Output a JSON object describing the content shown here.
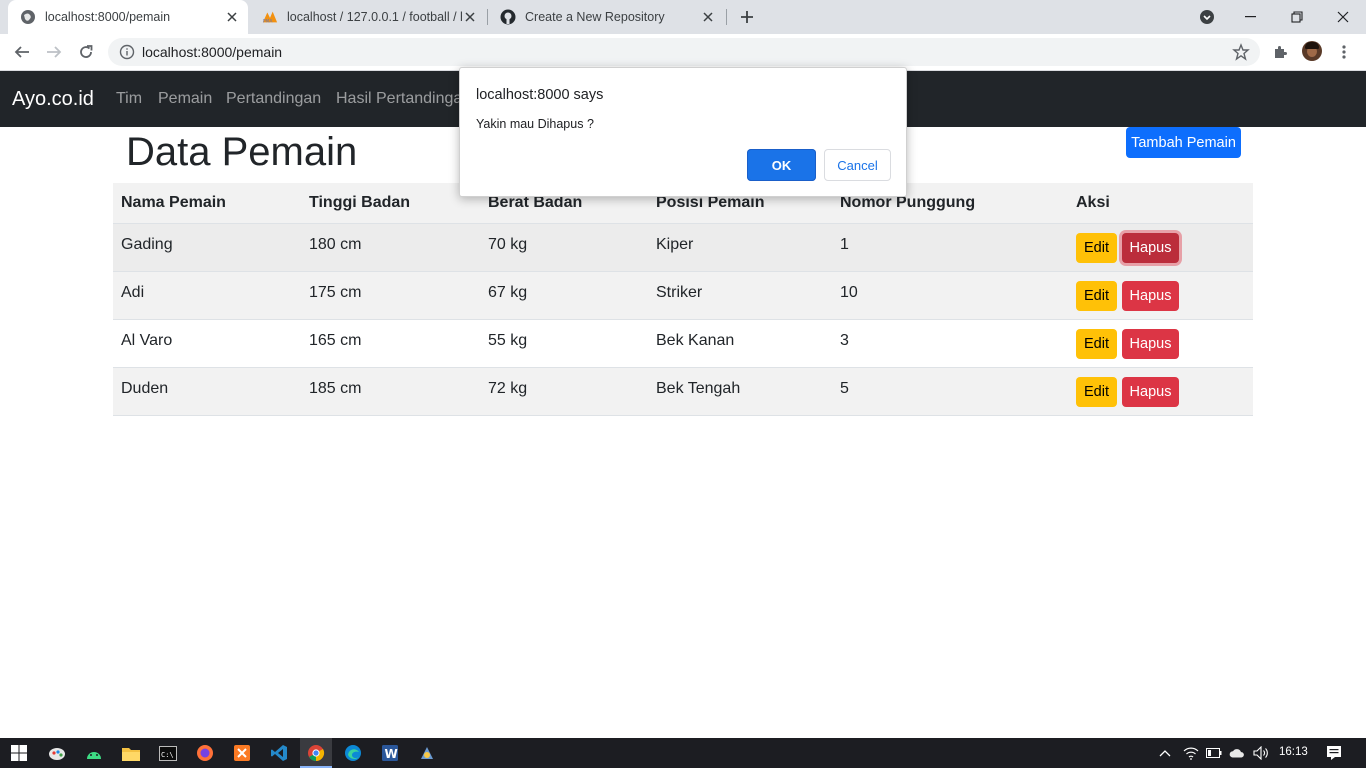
{
  "browser": {
    "tabs": [
      {
        "title": "localhost:8000/pemain",
        "active": true,
        "favicon": "globe-icon"
      },
      {
        "title": "localhost / 127.0.0.1 / football / h",
        "active": false,
        "favicon": "phpmyadmin-icon"
      },
      {
        "title": "Create a New Repository",
        "active": false,
        "favicon": "github-icon"
      }
    ],
    "url": "localhost:8000/pemain"
  },
  "navbar": {
    "brand": "Ayo.co.id",
    "links": [
      "Tim",
      "Pemain",
      "Pertandingan",
      "Hasil Pertandingan"
    ]
  },
  "page": {
    "title": "Data Pemain",
    "add_button": "Tambah Pemain"
  },
  "table": {
    "headers": [
      "Nama Pemain",
      "Tinggi Badan",
      "Berat Badan",
      "Posisi Pemain",
      "Nomor Punggung",
      "Aksi"
    ],
    "rows": [
      {
        "nama": "Gading",
        "tinggi": "180 cm",
        "berat": "70 kg",
        "posisi": "Kiper",
        "nomor": "1"
      },
      {
        "nama": "Adi",
        "tinggi": "175 cm",
        "berat": "67 kg",
        "posisi": "Striker",
        "nomor": "10"
      },
      {
        "nama": "Al Varo",
        "tinggi": "165 cm",
        "berat": "55 kg",
        "posisi": "Bek Kanan",
        "nomor": "3"
      },
      {
        "nama": "Duden",
        "tinggi": "185 cm",
        "berat": "72 kg",
        "posisi": "Bek Tengah",
        "nomor": "5"
      }
    ],
    "edit_label": "Edit",
    "delete_label": "Hapus"
  },
  "dialog": {
    "title": "localhost:8000 says",
    "message": "Yakin mau Dihapus ?",
    "ok_label": "OK",
    "cancel_label": "Cancel"
  },
  "taskbar": {
    "time": "16:13"
  },
  "colors": {
    "navbar_bg": "#212529",
    "primary": "#0d6efd",
    "warning": "#ffc107",
    "danger": "#dc3545",
    "dialog_ok": "#1a73e8"
  }
}
